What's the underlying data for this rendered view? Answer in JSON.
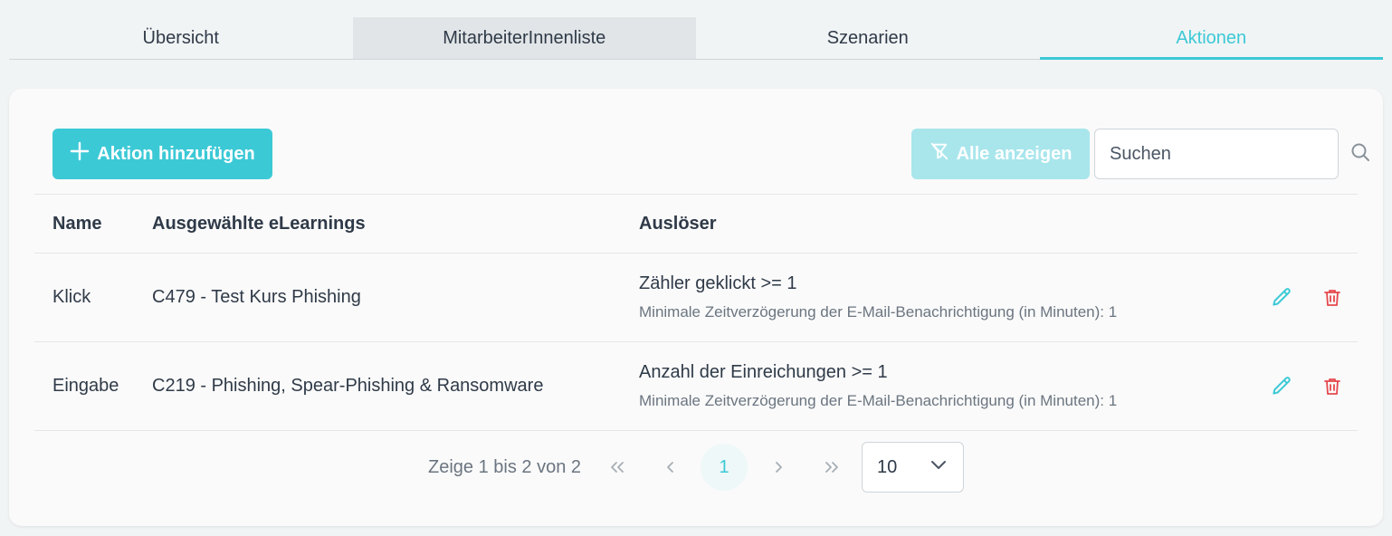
{
  "tabs": [
    {
      "label": "Übersicht"
    },
    {
      "label": "MitarbeiterInnenliste"
    },
    {
      "label": "Szenarien"
    },
    {
      "label": "Aktionen"
    }
  ],
  "toolbar": {
    "add_label": "Aktion hinzufügen",
    "filter_label": "Alle anzeigen",
    "search_placeholder": "Suchen"
  },
  "table": {
    "headers": {
      "name": "Name",
      "elearnings": "Ausgewählte eLearnings",
      "trigger": "Auslöser"
    },
    "rows": [
      {
        "name": "Klick",
        "elearning": "C479 - Test Kurs Phishing",
        "trigger": "Zähler geklickt >= 1",
        "delay": "Minimale Zeitverzögerung der E-Mail-Benachrichtigung (in Minuten): 1"
      },
      {
        "name": "Eingabe",
        "elearning": "C219 - Phishing, Spear-Phishing & Ransomware",
        "trigger": "Anzahl der Einreichungen >= 1",
        "delay": "Minimale Zeitverzögerung der E-Mail-Benachrichtigung (in Minuten): 1"
      }
    ]
  },
  "pagination": {
    "info": "Zeige 1 bis 2 von 2",
    "current_page": "1",
    "page_size": "10"
  },
  "colors": {
    "accent": "#3cc9d6",
    "accent_light": "#a8e6ec",
    "danger": "#e5484d",
    "text": "#2f3a48",
    "muted": "#6b7580"
  }
}
